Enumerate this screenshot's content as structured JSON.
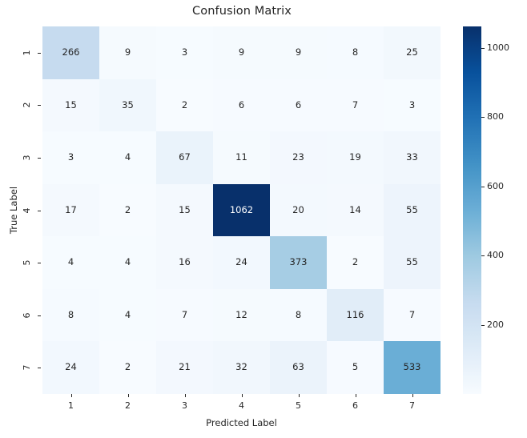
{
  "chart_data": {
    "type": "heatmap",
    "title": "Confusion Matrix",
    "xlabel": "Predicted Label",
    "ylabel": "True Label",
    "x_tick_labels": [
      "1",
      "2",
      "3",
      "4",
      "5",
      "6",
      "7"
    ],
    "y_tick_labels": [
      "1",
      "2",
      "3",
      "4",
      "5",
      "6",
      "7"
    ],
    "annotate": true,
    "grid": false,
    "colormap": "Blues",
    "vmin": 0,
    "vmax": 1062,
    "colorbar": {
      "position": "right",
      "ticks": [
        200,
        400,
        600,
        800,
        1000
      ],
      "tick_labels": [
        "200",
        "400",
        "600",
        "800",
        "1000"
      ]
    },
    "rows": [
      [
        266,
        9,
        3,
        9,
        9,
        8,
        25
      ],
      [
        15,
        35,
        2,
        6,
        6,
        7,
        3
      ],
      [
        3,
        4,
        67,
        11,
        23,
        19,
        33
      ],
      [
        17,
        2,
        15,
        1062,
        20,
        14,
        55
      ],
      [
        4,
        4,
        16,
        24,
        373,
        2,
        55
      ],
      [
        8,
        4,
        7,
        12,
        8,
        116,
        7
      ],
      [
        24,
        2,
        21,
        32,
        63,
        5,
        533
      ]
    ]
  },
  "figure": {
    "background_color": "#ffffff",
    "text_color": "#262626"
  }
}
